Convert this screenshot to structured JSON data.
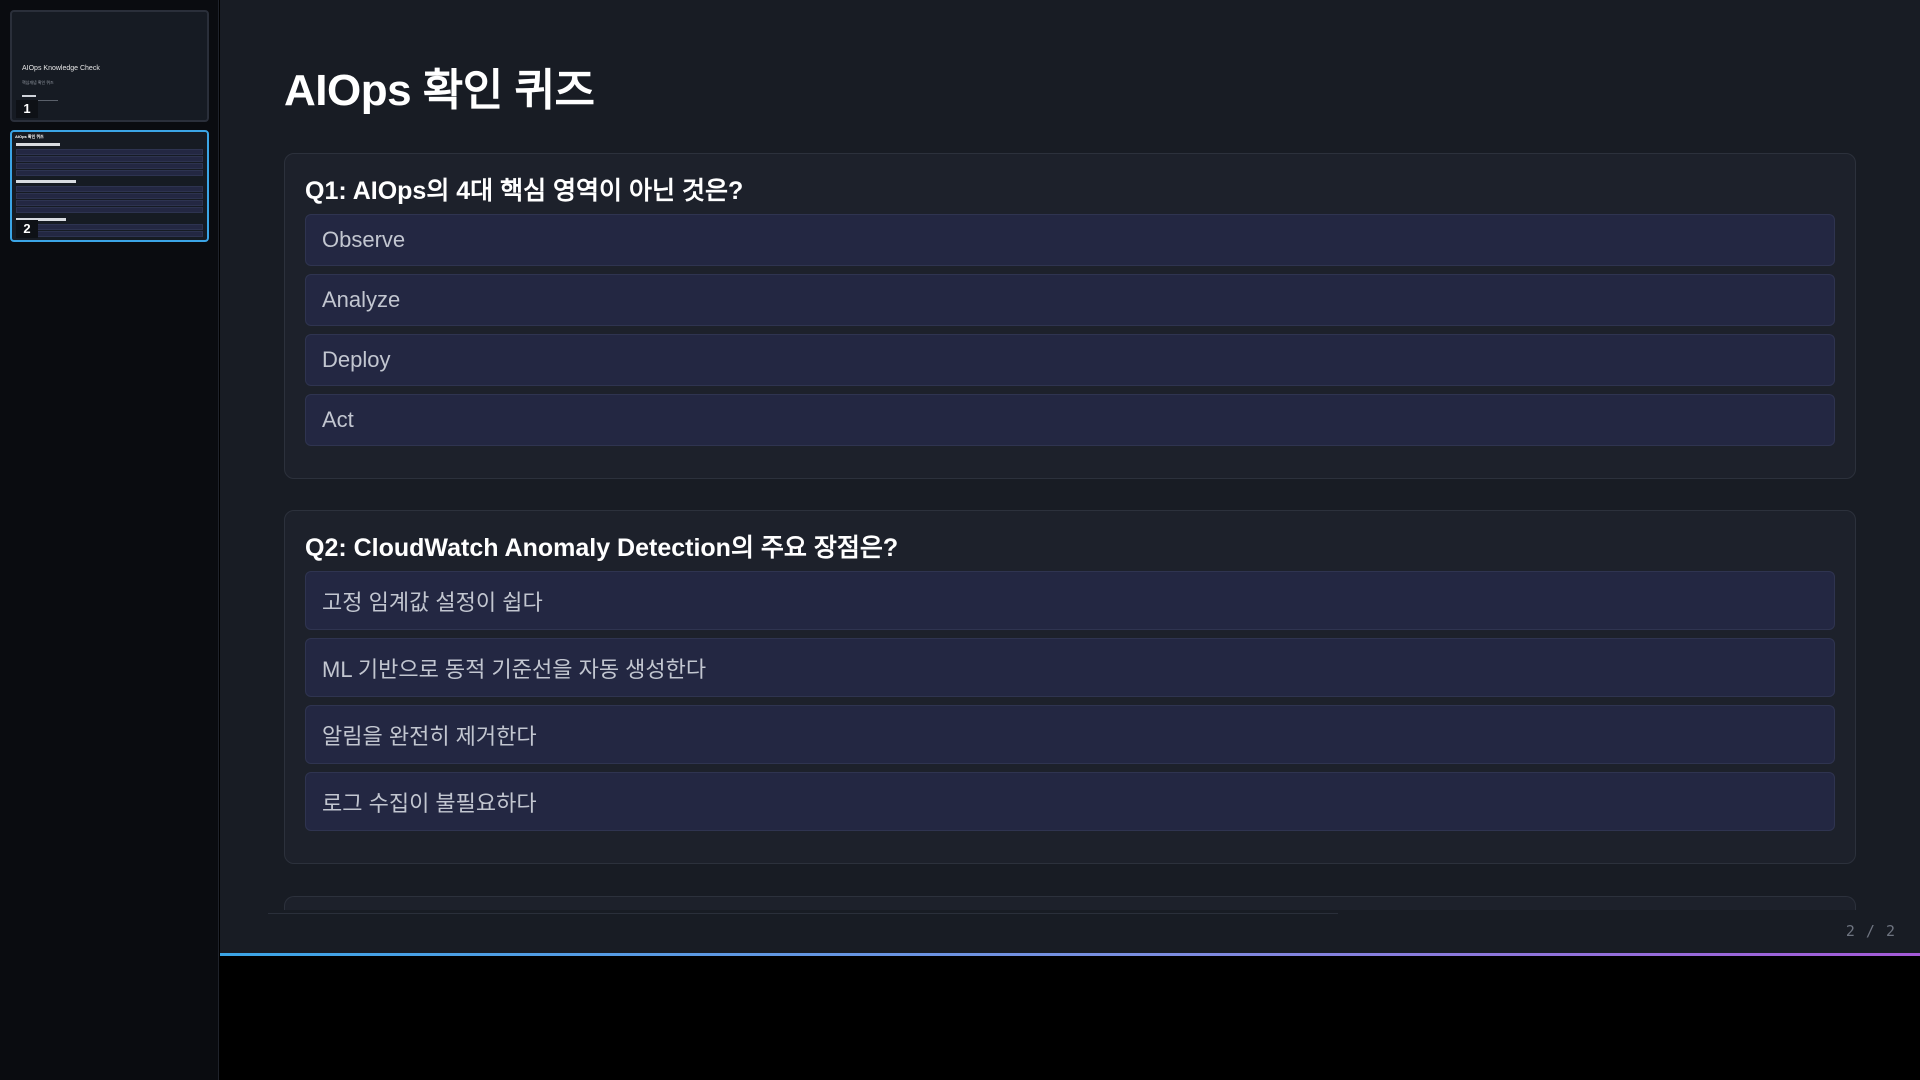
{
  "sidebar": {
    "thumbnails": [
      {
        "number": "1",
        "title": "AIOps Knowledge Check",
        "subtitle": "핵심개념 확인 퀴즈",
        "active": false
      },
      {
        "number": "2",
        "title": "AIOps 확인 퀴즈",
        "active": true
      }
    ]
  },
  "slide": {
    "title": "AIOps 확인 퀴즈",
    "questions": [
      {
        "title": "Q1: AIOps의 4대 핵심 영역이 아닌 것은?",
        "options": [
          "Observe",
          "Analyze",
          "Deploy",
          "Act"
        ]
      },
      {
        "title": "Q2: CloudWatch Anomaly Detection의 주요 장점은?",
        "options": [
          "고정 임계값 설정이 쉽다",
          "ML 기반으로 동적 기준선을 자동 생성한다",
          "알림을 완전히 제거한다",
          "로그 수집이 불필요하다"
        ]
      }
    ]
  },
  "footer": {
    "page_counter": "2 / 2"
  },
  "colors": {
    "accent": "#3ba5e6",
    "accent_end": "#a45ad8",
    "background": "#181c24",
    "option_bg": "#232742"
  }
}
